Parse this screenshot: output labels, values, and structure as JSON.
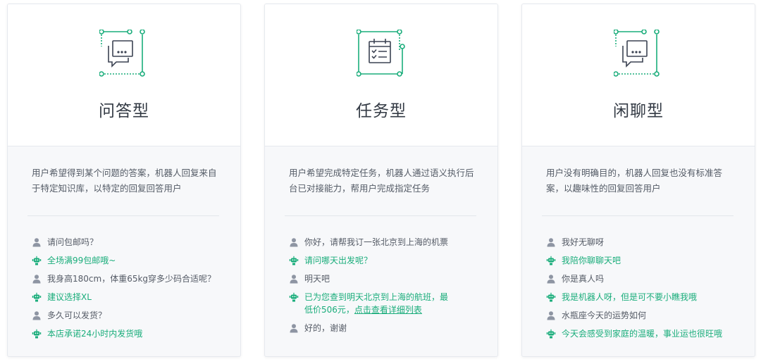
{
  "cards": [
    {
      "title": "问答型",
      "icon": "chat-bubble-icon",
      "description": "用户希望得到某个问题的答案，机器人回复来自于特定知识库，以特定的回复回答用户",
      "dialog": [
        {
          "role": "user",
          "text": "请问包邮吗？"
        },
        {
          "role": "bot",
          "text": "全场满99包邮哦~"
        },
        {
          "role": "user",
          "text": "我身高180cm，体重65kg穿多少码合适呢？"
        },
        {
          "role": "bot",
          "text": "建议选择XL"
        },
        {
          "role": "user",
          "text": "多久可以发货？"
        },
        {
          "role": "bot",
          "text": "本店承诺24小时内发货哦"
        }
      ]
    },
    {
      "title": "任务型",
      "icon": "task-calendar-icon",
      "description": "用户希望完成特定任务，机器人通过语义执行后台已对接能力，帮用户完成指定任务",
      "dialog": [
        {
          "role": "user",
          "text": "你好，请帮我订一张北京到上海的机票"
        },
        {
          "role": "bot",
          "text": "请问哪天出发呢？"
        },
        {
          "role": "user",
          "text": "明天吧"
        },
        {
          "role": "bot",
          "text": "已为您查到明天北京到上海的航班，最低价506元，",
          "link": "点击查看详细列表"
        },
        {
          "role": "user",
          "text": "好的，谢谢"
        }
      ]
    },
    {
      "title": "闲聊型",
      "icon": "chat-bubble-icon",
      "description": "用户没有明确目的，机器人回复也没有标准答案，以趣味性的回复回答用户",
      "dialog": [
        {
          "role": "user",
          "text": "我好无聊呀"
        },
        {
          "role": "bot",
          "text": "我陪你聊聊天吧"
        },
        {
          "role": "user",
          "text": "你是真人吗"
        },
        {
          "role": "bot",
          "text": "我是机器人呀，但是可不要小瞧我哦"
        },
        {
          "role": "user",
          "text": "水瓶座今天的运势如何"
        },
        {
          "role": "bot",
          "text": "今天会感受到家庭的温暖，事业运也很旺哦"
        }
      ]
    }
  ],
  "colors": {
    "accent": "#1aad7b",
    "user_icon": "#8e95a3",
    "text": "#555b66"
  }
}
